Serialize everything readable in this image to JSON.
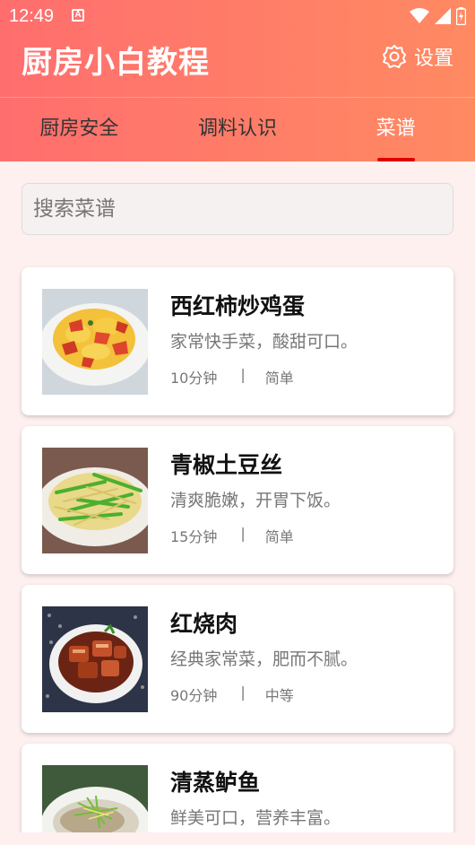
{
  "status_bar": {
    "time": "12:49",
    "notification_glyph": "A"
  },
  "app": {
    "title": "厨房小白教程",
    "settings_label": "设置"
  },
  "tabs": [
    {
      "label": "厨房安全",
      "active": false
    },
    {
      "label": "调料认识",
      "active": false
    },
    {
      "label": "菜谱",
      "active": true
    }
  ],
  "search": {
    "placeholder": "搜索菜谱"
  },
  "recipes": [
    {
      "name": "西红柿炒鸡蛋",
      "desc": "家常快手菜，酸甜可口。",
      "time": "10分钟",
      "sep": "|",
      "level": "简单"
    },
    {
      "name": "青椒土豆丝",
      "desc": "清爽脆嫩，开胃下饭。",
      "time": "15分钟",
      "sep": "|",
      "level": "简单"
    },
    {
      "name": "红烧肉",
      "desc": "经典家常菜，肥而不腻。",
      "time": "90分钟",
      "sep": "|",
      "level": "中等"
    },
    {
      "name": "清蒸鲈鱼",
      "desc": "鲜美可口，营养丰富。",
      "time": "",
      "sep": "",
      "level": ""
    }
  ],
  "colors": {
    "header_start": "#ff6e6e",
    "header_end": "#ff8a62",
    "tab_indicator": "#e00000",
    "background": "#fdf0ef"
  }
}
